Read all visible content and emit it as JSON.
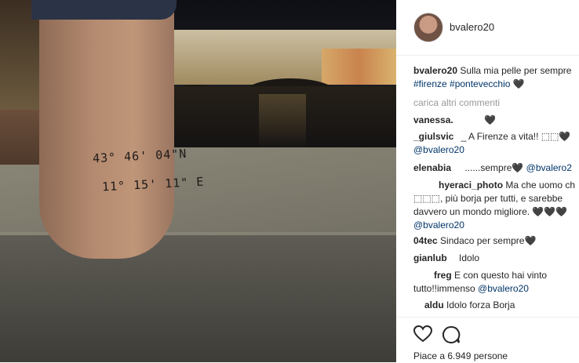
{
  "post": {
    "username": "bvalero20",
    "caption_user": "bvalero20",
    "caption_text": "Sulla mia pelle per sempre",
    "caption_tags": "#firenze #pontevecchio",
    "caption_heart": "🖤",
    "load_more": "carica altri commenti",
    "tattoo_line1": "43° 46' 04\"N",
    "tattoo_line2": "11° 15' 11\" E"
  },
  "comments": [
    {
      "user": "vanessa.",
      "text": "",
      "heart": "🖤"
    },
    {
      "user": "_giulsvic",
      "text": "_ A Firenze a vita!! ⬚⬚🖤",
      "mention": "@bvalero20"
    },
    {
      "user": "elenabia",
      "text": "......sempre🖤 ",
      "mention_inline": "@bvalero2"
    },
    {
      "user": "hyeraci_photo",
      "text": "Ma che uomo ch",
      "line2": "⬚⬚⬚, più borja per tutti, e sarebbe",
      "line3": "davvero un mondo migliore. 🖤🖤🖤",
      "mention": "@bvalero20"
    },
    {
      "user": "04tec",
      "text": "Sindaco per sempre🖤"
    },
    {
      "user": "gianlub",
      "text": "Idolo"
    },
    {
      "user": "freg",
      "text": "E con questo hai vinto",
      "line2": "tutto!!immenso ",
      "mention_inline": "@bvalero20"
    },
    {
      "user": "aldu",
      "text": "Idolo forza Borja"
    }
  ],
  "actions": {
    "like_icon": "heart-icon",
    "comment_icon": "comment-icon",
    "likes_text": "Piace a 6.949 persone"
  }
}
